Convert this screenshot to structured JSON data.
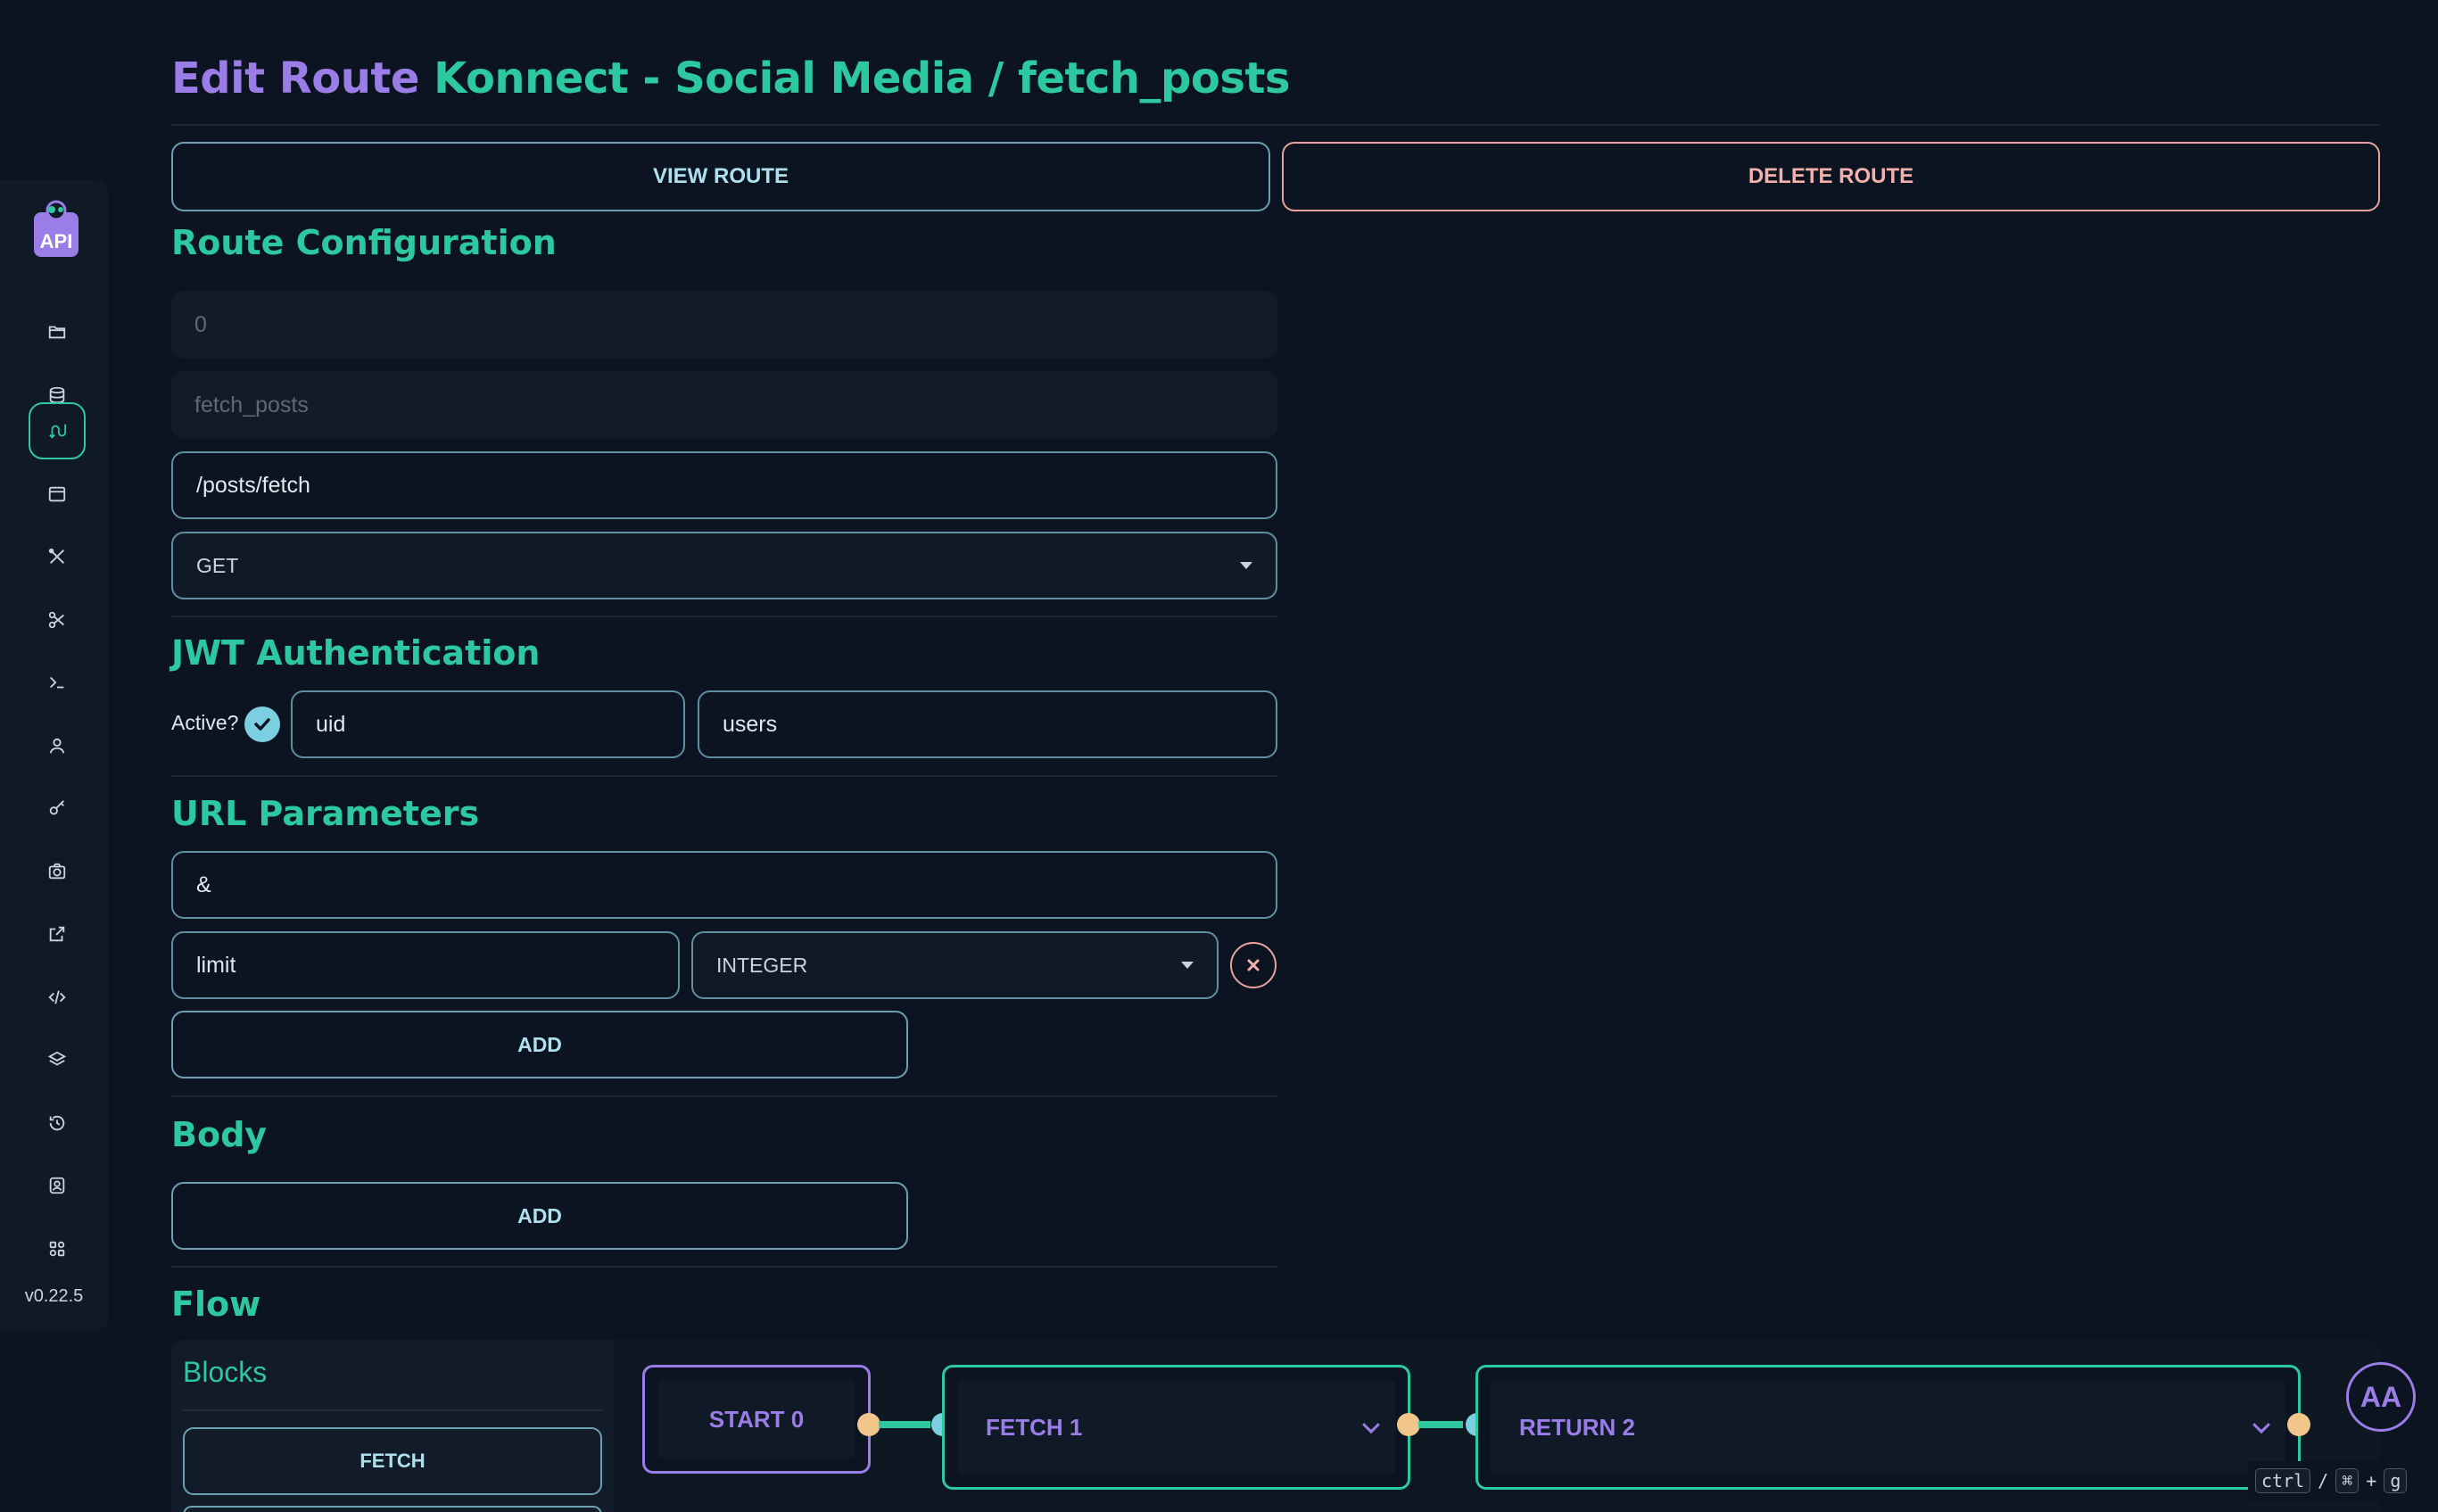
{
  "title": {
    "edit": "Edit Route",
    "rest": "Konnect - Social Media / fetch_posts"
  },
  "actions": {
    "view": "VIEW ROUTE",
    "delete": "DELETE ROUTE"
  },
  "route_config": {
    "heading": "Route Configuration",
    "id_value": "0",
    "name_value": "fetch_posts",
    "path_value": "/posts/fetch",
    "method_value": "GET"
  },
  "jwt": {
    "heading": "JWT Authentication",
    "active_label": "Active?",
    "field_value": "uid",
    "table_value": "users"
  },
  "url_params": {
    "heading": "URL Parameters",
    "separator_value": "&",
    "param_name": "limit",
    "param_type": "INTEGER",
    "add_label": "ADD"
  },
  "body": {
    "heading": "Body",
    "add_label": "ADD"
  },
  "flow": {
    "heading": "Flow",
    "blocks_title": "Blocks",
    "block_items": [
      "FETCH"
    ],
    "nodes": [
      "START 0",
      "FETCH 1",
      "RETURN 2"
    ]
  },
  "sidebar": {
    "version": "v0.22.5",
    "items": [
      "logo",
      "folder-icon",
      "database-icon",
      "route-icon",
      "window-icon",
      "tools-icon",
      "scissors-icon",
      "terminal-icon",
      "user-icon",
      "key-icon",
      "camera-icon",
      "external-link-icon",
      "code-icon",
      "layers-icon",
      "history-icon",
      "badge-icon",
      "settings-icon"
    ]
  },
  "user": {
    "initials": "AA"
  },
  "shortcut": {
    "k1": "ctrl",
    "sep": "/",
    "k2": "⌘",
    "plus": "+",
    "k3": "g"
  },
  "colors": {
    "accent": "#2ec8a0",
    "purple": "#9b7de8",
    "danger": "#e8a2a0",
    "cyan": "#7ccfe0",
    "peach": "#f2c58a"
  }
}
